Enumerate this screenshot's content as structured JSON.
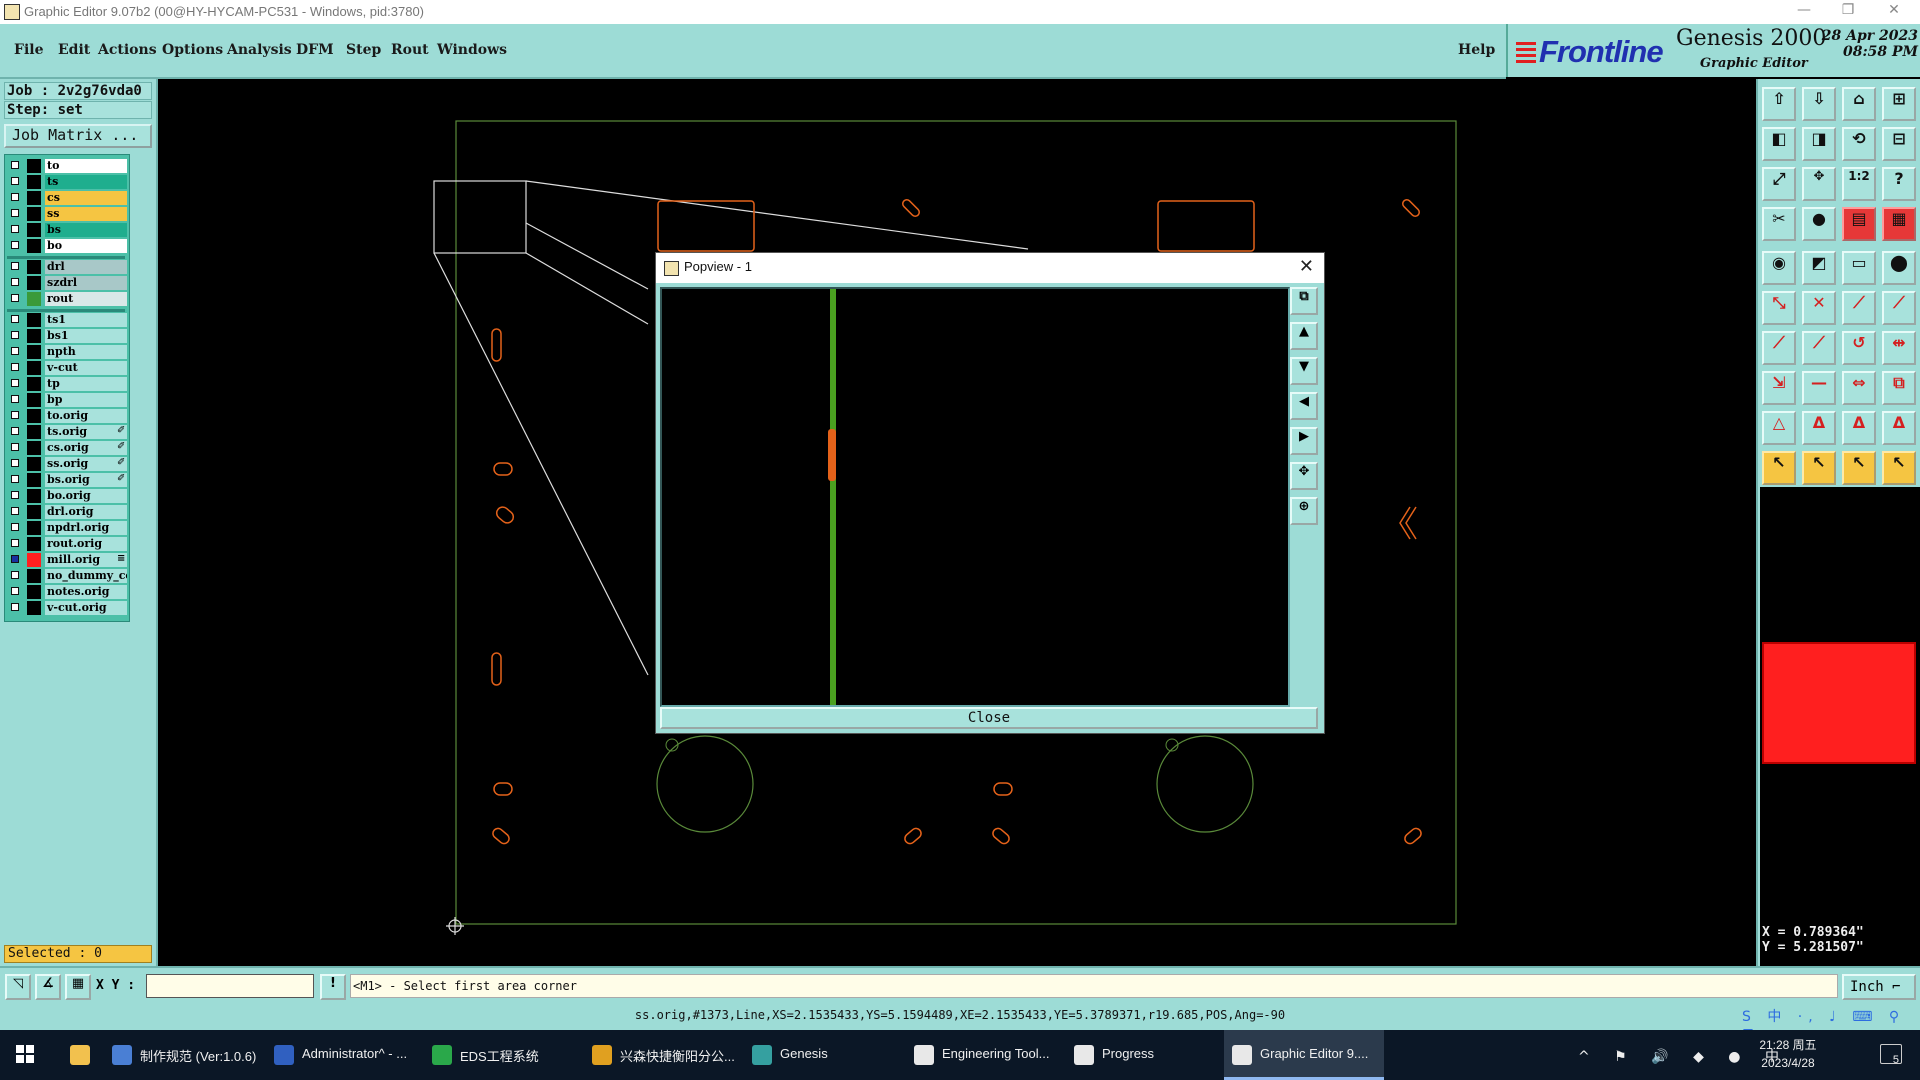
{
  "window": {
    "title": "Graphic Editor 9.07b2 (00@HY-HYCAM-PC531 - Windows, pid:3780)",
    "controls": [
      "—",
      "❐",
      "✕"
    ]
  },
  "menu": [
    "File",
    "Edit",
    "Actions",
    "Options",
    "Analysis",
    "DFM",
    "Step",
    "Rout",
    "Windows"
  ],
  "help": "Help",
  "brand": {
    "logo": "Frontline",
    "product": "Genesis 2000",
    "subtitle": "Graphic Editor",
    "date": "28 Apr 2023",
    "time": "08:58 PM"
  },
  "job": {
    "job_line": "Job : 2v2g76vda0",
    "step_line": "Step: set",
    "matrix_button": "Job Matrix ..."
  },
  "layers": [
    {
      "name": "to",
      "bg": "#ffffff",
      "swatch": "#000000"
    },
    {
      "name": "ts",
      "bg": "#1fae8e",
      "swatch": "#000000"
    },
    {
      "name": "cs",
      "bg": "#f5c542",
      "swatch": "#000000"
    },
    {
      "name": "ss",
      "bg": "#f5c542",
      "swatch": "#000000"
    },
    {
      "name": "bs",
      "bg": "#1fae8e",
      "swatch": "#000000"
    },
    {
      "name": "bo",
      "bg": "#ffffff",
      "swatch": "#000000"
    },
    {
      "name": "drl",
      "bg": "#a8c8c8",
      "swatch": "#000000"
    },
    {
      "name": "szdrl",
      "bg": "#a8c8c8",
      "swatch": "#000000"
    },
    {
      "name": "rout",
      "bg": "#d8e8e8",
      "swatch": "#3a9a3a"
    },
    {
      "name": "ts1",
      "bg": "#a8e2dc",
      "swatch": "#000000"
    },
    {
      "name": "bs1",
      "bg": "#a8e2dc",
      "swatch": "#000000"
    },
    {
      "name": "npth",
      "bg": "#a8e2dc",
      "swatch": "#000000"
    },
    {
      "name": "v-cut",
      "bg": "#a8e2dc",
      "swatch": "#000000"
    },
    {
      "name": "tp",
      "bg": "#a8e2dc",
      "swatch": "#000000"
    },
    {
      "name": "bp",
      "bg": "#a8e2dc",
      "swatch": "#000000"
    },
    {
      "name": "to.orig",
      "bg": "#a8e2dc",
      "swatch": "#000000"
    },
    {
      "name": "ts.orig",
      "bg": "#a8e2dc",
      "swatch": "#000000",
      "mark": "✐"
    },
    {
      "name": "cs.orig",
      "bg": "#a8e2dc",
      "swatch": "#000000",
      "mark": "✐"
    },
    {
      "name": "ss.orig",
      "bg": "#a8e2dc",
      "swatch": "#000000",
      "mark": "✐"
    },
    {
      "name": "bs.orig",
      "bg": "#a8e2dc",
      "swatch": "#000000",
      "mark": "✐"
    },
    {
      "name": "bo.orig",
      "bg": "#a8e2dc",
      "swatch": "#000000"
    },
    {
      "name": "drl.orig",
      "bg": "#a8e2dc",
      "swatch": "#000000"
    },
    {
      "name": "npdrl.orig",
      "bg": "#a8e2dc",
      "swatch": "#000000"
    },
    {
      "name": "rout.orig",
      "bg": "#a8e2dc",
      "swatch": "#000000"
    },
    {
      "name": "mill.orig",
      "bg": "#a8e2dc",
      "swatch": "#ff1f1f",
      "mark": "≡",
      "checked": true
    },
    {
      "name": "no_dummy_copy",
      "bg": "#a8e2dc",
      "swatch": "#000000"
    },
    {
      "name": "notes.orig",
      "bg": "#a8e2dc",
      "swatch": "#000000"
    },
    {
      "name": "v-cut.orig",
      "bg": "#a8e2dc",
      "swatch": "#000000"
    }
  ],
  "selected": "Selected : 0",
  "popview": {
    "title": "Popview - 1",
    "close": "Close",
    "close_x": "✕"
  },
  "toolbar_icons": [
    "zoom-home-icon",
    "zoom-page-icon",
    "home-icon",
    "split-view-icon",
    "pan-left-icon",
    "pan-right-icon",
    "redraw-icon",
    "snap-icon",
    "fit-icon",
    "zoom-icon",
    "one-to-one-icon",
    "query-icon",
    "measure-icon",
    "pad-icon",
    "layer-color-icon",
    "layer-select-icon",
    "pad-add-icon",
    "cut-icon",
    "ruler-icon",
    "circle-icon",
    "connect-icon",
    "delete-node-icon",
    "node-red-icon",
    "node-blue-icon",
    "line-add-icon",
    "line-edit-icon",
    "arc-icon",
    "mirror-icon",
    "move-icon",
    "minus-icon",
    "stretch-icon",
    "copy-icon",
    "triangle-icon",
    "triangle-a-icon",
    "triangle-b-icon",
    "triangle-c-icon",
    "select-pointer-icon",
    "select-box-icon",
    "select-touch-icon",
    "select-net-icon"
  ],
  "coords": {
    "x": "X = 0.789364\"",
    "y": "Y = 5.281507\""
  },
  "command": {
    "xy_label": "X Y :",
    "xy_value": "",
    "prompt": "<M1> - Select first area corner",
    "units": "Inch ⌐"
  },
  "status": "ss.orig,#1373,Line,XS=2.1535433,YS=5.1594489,XE=2.1535433,YE=5.3789371,r19.685,POS,Ang=-90",
  "ime": "S 中 ·, ♩ ⌨ ⚲ ⊞",
  "taskbar": {
    "items": [
      {
        "label": "",
        "icon": "start-icon"
      },
      {
        "label": "",
        "icon": "folder-icon"
      },
      {
        "label": "制作规范 (Ver:1.0.6)",
        "icon": "doc-icon"
      },
      {
        "label": "Administrator^ - ...",
        "icon": "disk-icon"
      },
      {
        "label": "EDS工程系统",
        "icon": "frontline-icon"
      },
      {
        "label": "兴森快捷衡阳分公...",
        "icon": "browser-icon"
      },
      {
        "label": "Genesis",
        "icon": "genesis-icon"
      },
      {
        "label": "Engineering Tool...",
        "icon": "app-icon"
      },
      {
        "label": "Progress",
        "icon": "app-icon"
      },
      {
        "label": "Graphic Editor 9....",
        "icon": "app-icon"
      }
    ],
    "tray": "^ ⚑ 🔊 ◆ ● 中",
    "clock_time": "21:28 周五",
    "clock_date": "2023/4/28",
    "notifications": "5"
  }
}
